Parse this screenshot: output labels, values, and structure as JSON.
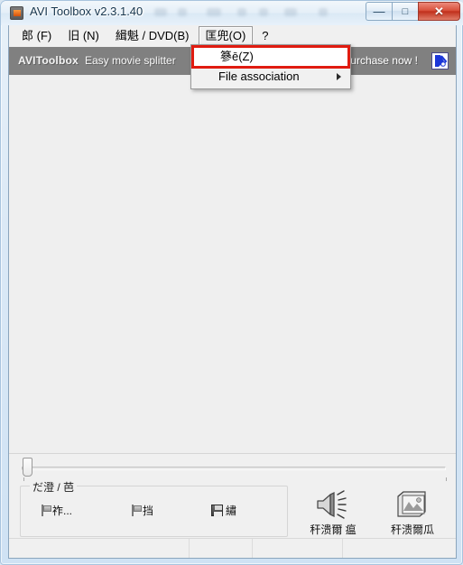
{
  "window": {
    "title": "AVI Toolbox v2.3.1.40",
    "icon": "film-reel-icon",
    "controls": {
      "minimize": "—",
      "maximize": "□",
      "close": "✕"
    }
  },
  "menubar": {
    "items": [
      {
        "label": "郎  (F)",
        "active": false
      },
      {
        "label": "旧  (N)",
        "active": false
      },
      {
        "label": "緝魁 / DVD(B)",
        "active": false
      },
      {
        "label": "匡兜(O)",
        "active": true
      },
      {
        "label": "?",
        "active": false
      }
    ]
  },
  "dropdown": {
    "items": [
      {
        "label": "篸ē(Z)",
        "highlighted": true,
        "has_submenu": false
      },
      {
        "label": "File association",
        "highlighted": false,
        "has_submenu": true
      }
    ],
    "highlight_color": "#e01b10"
  },
  "banner": {
    "brand": "AVIToolbox",
    "tagline": "Easy movie splitter",
    "purchase": "Purchase now !",
    "logo": "avi-toolbox-logo-icon",
    "background": "#808080"
  },
  "trackbar": {
    "value": 0,
    "min": 0,
    "max": 100
  },
  "bottom_panel": {
    "group_label": "だ澄 /   芭",
    "buttons": [
      {
        "label": "祚...",
        "icon": "flag-start-icon"
      },
      {
        "label": "挡",
        "icon": "flag-end-icon"
      },
      {
        "label": "繡",
        "icon": "save-disk-icon"
      }
    ],
    "icon_buttons": [
      {
        "label": "秆溃爾  瘟",
        "icon": "speaker-icon"
      },
      {
        "label": "秆溃爾瓜",
        "icon": "picture-icon"
      }
    ]
  },
  "statusbar": {
    "cells": [
      "",
      "",
      "",
      ""
    ],
    "grip": "resize-grip-icon"
  }
}
